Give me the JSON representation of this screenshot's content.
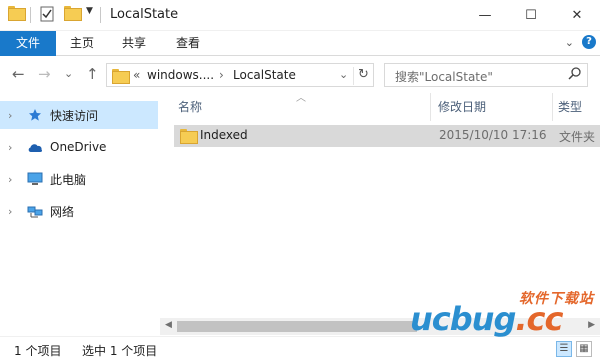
{
  "window": {
    "title": "LocalState",
    "minimize": "—",
    "maximize": "☐",
    "close": "✕"
  },
  "ribbon": {
    "tabs": [
      "文件",
      "主页",
      "共享",
      "查看"
    ],
    "expand": "⌄",
    "help": "?"
  },
  "address": {
    "back": "←",
    "forward": "→",
    "recent": "⌄",
    "up": "↑",
    "overflow": "«",
    "crumbs": [
      "windows....",
      "LocalState"
    ],
    "crumb_sep": "›",
    "dropdown": "⌄",
    "refresh": "↻"
  },
  "search": {
    "placeholder": "搜索\"LocalState\"",
    "icon": "search-icon"
  },
  "navpane": {
    "items": [
      {
        "label": "快速访问",
        "icon": "star-icon",
        "selected": true
      },
      {
        "label": "OneDrive",
        "icon": "cloud-icon",
        "selected": false
      },
      {
        "label": "此电脑",
        "icon": "computer-icon",
        "selected": false
      },
      {
        "label": "网络",
        "icon": "network-icon",
        "selected": false
      }
    ]
  },
  "columns": {
    "name": "名称",
    "date": "修改日期",
    "type": "类型"
  },
  "files": [
    {
      "name": "Indexed",
      "date": "2015/10/10 17:16",
      "type": "文件夹"
    }
  ],
  "statusbar": {
    "count": "1 个项目",
    "selected": "选中 1 个项目"
  },
  "watermark": {
    "top": "软件下载站",
    "main_left": "ucbug",
    "main_right": ".cc"
  },
  "colors": {
    "accent": "#1979ca",
    "selection": "#cce8ff",
    "row_selected": "#d9d9d9"
  }
}
